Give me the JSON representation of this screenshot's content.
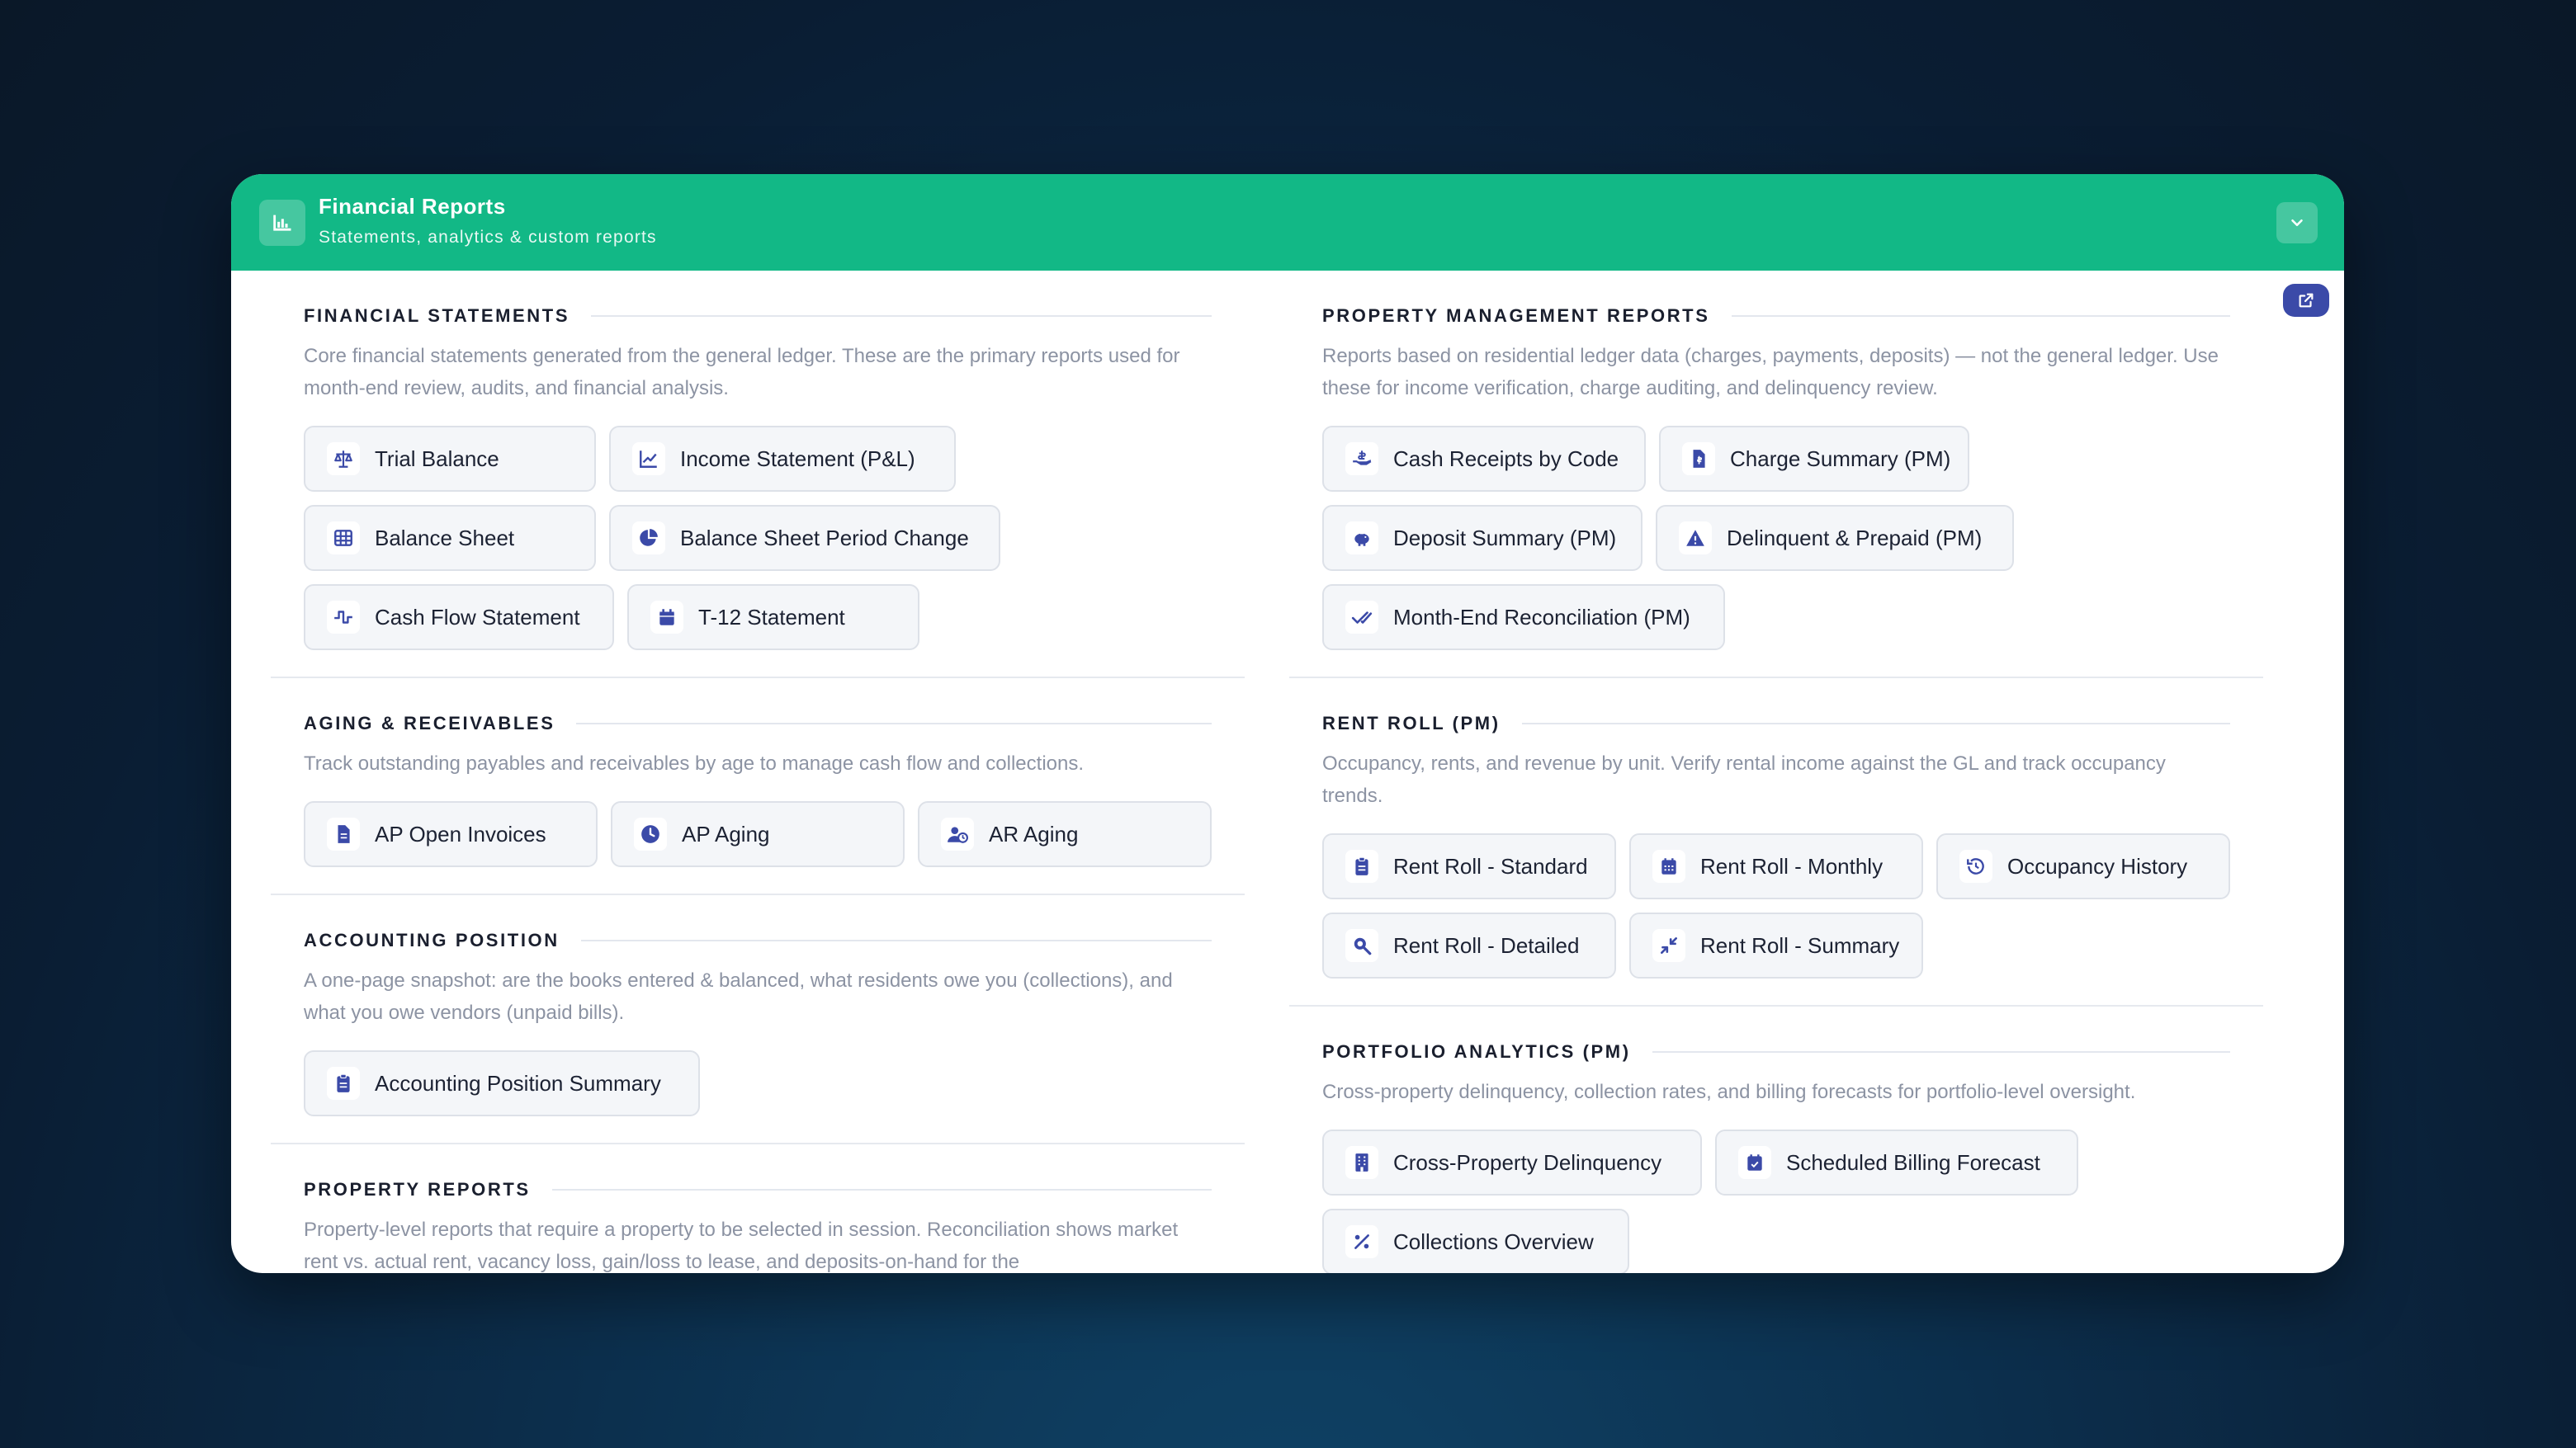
{
  "header": {
    "title": "Financial Reports",
    "subtitle": "Statements, analytics & custom reports",
    "icon": "bar-chart-icon",
    "color": "#12b886"
  },
  "left": {
    "financial_statements": {
      "title": "FINANCIAL STATEMENTS",
      "description": "Core financial statements generated from the general ledger. These are the primary reports used for month-end review, audits, and financial analysis.",
      "buttons": [
        "Trial Balance",
        "Income Statement (P&L)",
        "Balance Sheet",
        "Balance Sheet Period Change",
        "Cash Flow Statement",
        "T-12 Statement"
      ]
    },
    "aging": {
      "title": "AGING & RECEIVABLES",
      "description": "Track outstanding payables and receivables by age to manage cash flow and collections.",
      "buttons": [
        "AP Open Invoices",
        "AP Aging",
        "AR Aging"
      ]
    },
    "accounting_position": {
      "title": "ACCOUNTING POSITION",
      "description": "A one-page snapshot: are the books entered & balanced, what residents owe you (collections), and what you owe vendors (unpaid bills).",
      "buttons": [
        "Accounting Position Summary"
      ]
    },
    "property_reports": {
      "title": "PROPERTY REPORTS",
      "description": "Property-level reports that require a property to be selected in session. Reconciliation shows market rent vs. actual rent, vacancy loss, gain/loss to lease, and deposits-on-hand for the"
    }
  },
  "right": {
    "pm_reports": {
      "title": "PROPERTY MANAGEMENT REPORTS",
      "description": "Reports based on residential ledger data (charges, payments, deposits) — not the general ledger. Use these for income verification, charge auditing, and delinquency review.",
      "buttons": [
        "Cash Receipts by Code",
        "Charge Summary (PM)",
        "Deposit Summary (PM)",
        "Delinquent & Prepaid (PM)",
        "Month-End Reconciliation (PM)"
      ]
    },
    "rent_roll": {
      "title": "RENT ROLL (PM)",
      "description": "Occupancy, rents, and revenue by unit. Verify rental income against the GL and track occupancy trends.",
      "buttons": [
        "Rent Roll - Standard",
        "Rent Roll - Monthly",
        "Occupancy History",
        "Rent Roll - Detailed",
        "Rent Roll - Summary"
      ]
    },
    "portfolio": {
      "title": "PORTFOLIO ANALYTICS (PM)",
      "description": "Cross-property delinquency, collection rates, and billing forecasts for portfolio-level oversight.",
      "buttons": [
        "Cross-Property Delinquency",
        "Scheduled Billing Forecast",
        "Collections Overview"
      ]
    }
  },
  "colors": {
    "accent": "#12b886",
    "icon": "#3b4aa8",
    "button_bg": "#f4f6f9",
    "muted_text": "#8c93a3"
  }
}
